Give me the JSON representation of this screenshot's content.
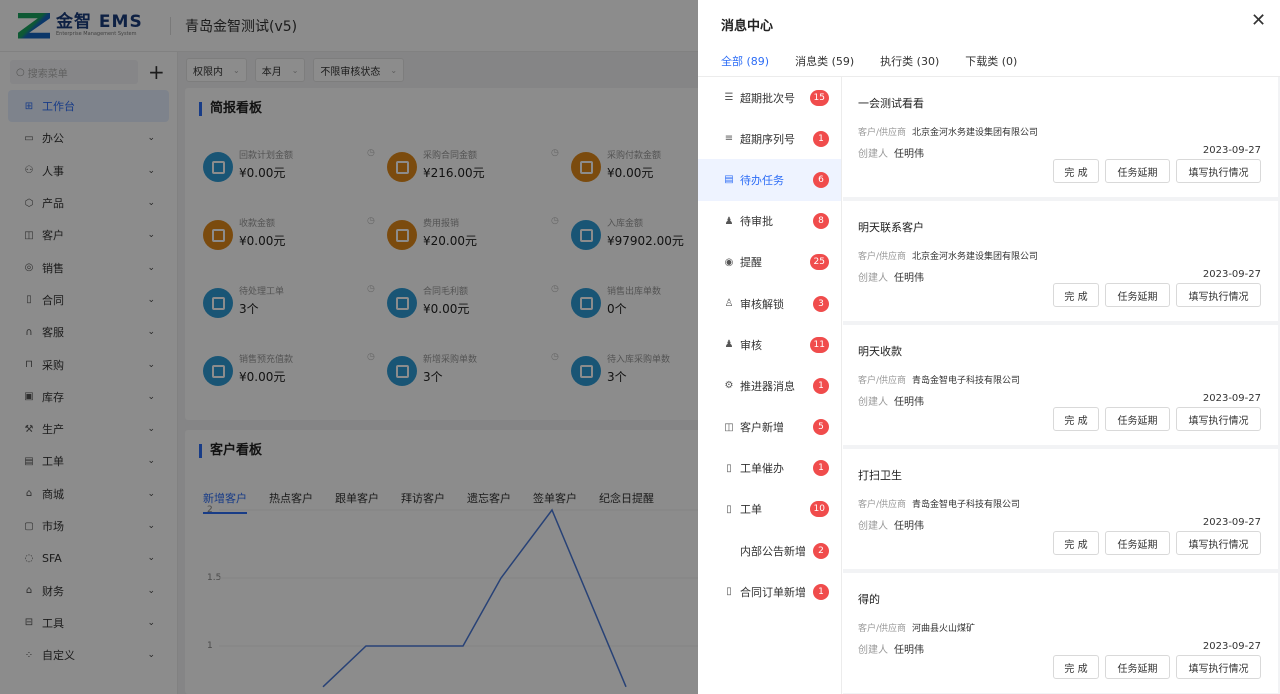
{
  "header": {
    "logo_title": "金智 EMS",
    "logo_sub": "Enterprise Management System",
    "company": "青岛金智测试(v5)"
  },
  "sidebar": {
    "search_placeholder": "搜索菜单",
    "items": [
      {
        "label": "工作台",
        "icon": "grid-icon",
        "glyph": "⊞",
        "active": true
      },
      {
        "label": "办公",
        "icon": "briefcase-icon",
        "glyph": "▭"
      },
      {
        "label": "人事",
        "icon": "people-icon",
        "glyph": "⚇"
      },
      {
        "label": "产品",
        "icon": "cube-icon",
        "glyph": "⬡"
      },
      {
        "label": "客户",
        "icon": "chart-icon",
        "glyph": "◫"
      },
      {
        "label": "销售",
        "icon": "target-icon",
        "glyph": "◎"
      },
      {
        "label": "合同",
        "icon": "document-icon",
        "glyph": "▯"
      },
      {
        "label": "客服",
        "icon": "headset-icon",
        "glyph": "∩"
      },
      {
        "label": "采购",
        "icon": "bag-icon",
        "glyph": "⊓"
      },
      {
        "label": "库存",
        "icon": "warehouse-icon",
        "glyph": "▣"
      },
      {
        "label": "生产",
        "icon": "factory-icon",
        "glyph": "⚒"
      },
      {
        "label": "工单",
        "icon": "ticket-icon",
        "glyph": "▤"
      },
      {
        "label": "商城",
        "icon": "store-icon",
        "glyph": "⌂"
      },
      {
        "label": "市场",
        "icon": "market-icon",
        "glyph": "▢"
      },
      {
        "label": "SFA",
        "icon": "sfa-icon",
        "glyph": "◌"
      },
      {
        "label": "财务",
        "icon": "finance-icon",
        "glyph": "⌂"
      },
      {
        "label": "工具",
        "icon": "toolbox-icon",
        "glyph": "⊟"
      },
      {
        "label": "自定义",
        "icon": "apps-icon",
        "glyph": "⁘"
      }
    ]
  },
  "filters": [
    "权限内",
    "本月",
    "不限审核状态"
  ],
  "board": {
    "title": "简报看板",
    "stats": [
      {
        "label": "回款计划金额",
        "value": "¥0.00元",
        "color": "#2e9bd6"
      },
      {
        "label": "采购合同金额",
        "value": "¥216.00元",
        "color": "#e0891b"
      },
      {
        "label": "采购付款金额",
        "value": "¥0.00元",
        "color": "#e0891b"
      },
      {
        "label": "收款金额",
        "value": "¥0.00元",
        "color": "#e0891b"
      },
      {
        "label": "费用报销",
        "value": "¥20.00元",
        "color": "#e0891b"
      },
      {
        "label": "入库金额",
        "value": "¥97902.00元",
        "color": "#2e9bd6"
      },
      {
        "label": "待处理工单",
        "value": "3个",
        "color": "#2e9bd6"
      },
      {
        "label": "合同毛利额",
        "value": "¥0.00元",
        "color": "#2e9bd6"
      },
      {
        "label": "销售出库单数",
        "value": "0个",
        "color": "#2e9bd6"
      },
      {
        "label": "销售预充值款",
        "value": "¥0.00元",
        "color": "#2e9bd6"
      },
      {
        "label": "新增采购单数",
        "value": "3个",
        "color": "#2e9bd6"
      },
      {
        "label": "待入库采购单数",
        "value": "3个",
        "color": "#2e9bd6"
      }
    ]
  },
  "customer_board": {
    "title": "客户看板",
    "tabs": [
      "新增客户",
      "热点客户",
      "跟单客户",
      "拜访客户",
      "遗忘客户",
      "签单客户",
      "纪念日提醒"
    ],
    "y_ticks": [
      "2",
      "1.5",
      "1"
    ]
  },
  "chart_data": {
    "type": "line",
    "title": "",
    "xlabel": "",
    "ylabel": "",
    "y_ticks": [
      2,
      1.5,
      1
    ],
    "series": [
      {
        "values": [
          0.7,
          1,
          1,
          1.5,
          2,
          0.7
        ]
      }
    ],
    "note": "chart partially hidden by overlay; x-axis labels not visible"
  },
  "drawer": {
    "title": "消息中心",
    "close": "✕",
    "tabs": [
      "全部 (89)",
      "消息类 (59)",
      "执行类 (30)",
      "下载类 (0)"
    ],
    "categories": [
      {
        "label": "超期批次号",
        "count": "15",
        "icon": "list-icon",
        "glyph": "☰"
      },
      {
        "label": "超期序列号",
        "count": "1",
        "icon": "menu-icon",
        "glyph": "≡"
      },
      {
        "label": "待办任务",
        "count": "6",
        "icon": "task-icon",
        "glyph": "▤",
        "active": true
      },
      {
        "label": "待审批",
        "count": "8",
        "icon": "user-icon",
        "glyph": "♟"
      },
      {
        "label": "提醒",
        "count": "25",
        "icon": "bell-icon",
        "glyph": "◉"
      },
      {
        "label": "审核解锁",
        "count": "3",
        "icon": "unlock-user-icon",
        "glyph": "♙"
      },
      {
        "label": "审核",
        "count": "11",
        "icon": "audit-icon",
        "glyph": "♟"
      },
      {
        "label": "推进器消息",
        "count": "1",
        "icon": "gear-icon",
        "glyph": "⚙"
      },
      {
        "label": "客户新增",
        "count": "5",
        "icon": "bar-chart-icon",
        "glyph": "◫"
      },
      {
        "label": "工单催办",
        "count": "1",
        "icon": "file-icon",
        "glyph": "▯"
      },
      {
        "label": "工单",
        "count": "10",
        "icon": "ticket-icon",
        "glyph": "▯"
      },
      {
        "label": "内部公告新增",
        "count": "2",
        "icon": "",
        "glyph": ""
      },
      {
        "label": "合同订单新增",
        "count": "1",
        "icon": "contract-icon",
        "glyph": "▯"
      }
    ],
    "customer_label": "客户/供应商",
    "creator_label": "创建人",
    "actions": [
      "完 成",
      "任务延期",
      "填写执行情况"
    ],
    "messages": [
      {
        "title": "一会测试看看",
        "customer": "北京金河水务建设集团有限公司",
        "creator": "任明伟",
        "date": "2023-09-27"
      },
      {
        "title": "明天联系客户",
        "customer": "北京金河水务建设集团有限公司",
        "creator": "任明伟",
        "date": "2023-09-27"
      },
      {
        "title": "明天收款",
        "customer": "青岛金智电子科技有限公司",
        "creator": "任明伟",
        "date": "2023-09-27"
      },
      {
        "title": "打扫卫生",
        "customer": "青岛金智电子科技有限公司",
        "creator": "任明伟",
        "date": "2023-09-27"
      },
      {
        "title": "得的",
        "customer": "河曲县火山煤矿",
        "creator": "任明伟",
        "date": "2023-09-27"
      }
    ]
  }
}
